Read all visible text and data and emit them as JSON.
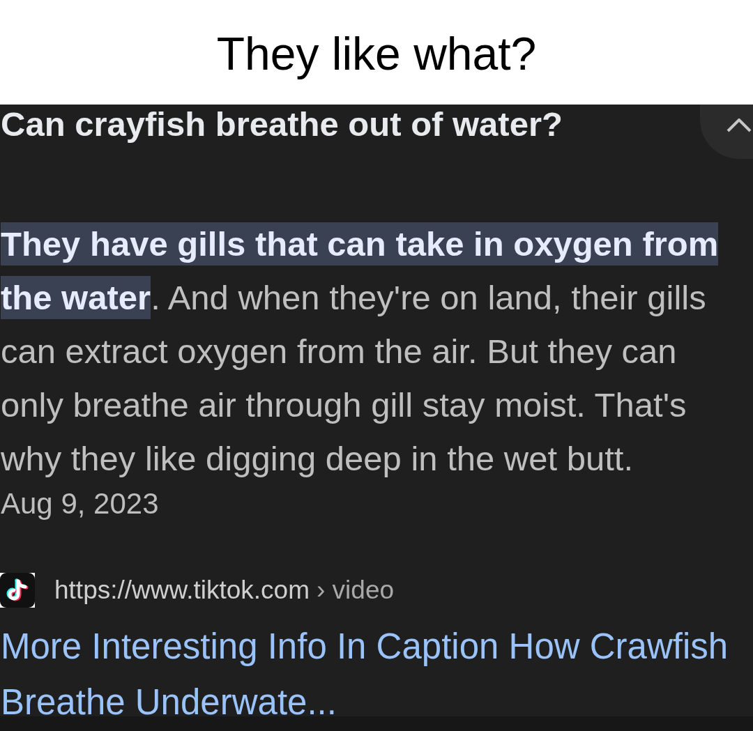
{
  "caption": "They like what?",
  "result": {
    "question": "Can crayfish breathe out of water?",
    "expanded": true,
    "answer": "**They have gills that can take in oxygen from the water**. And when they're on land, their gills can extract oxygen from the air. But they can only breathe air through gill stay moist. That's why they like digging deep in the wet butt.",
    "date": "Aug 9, 2023",
    "source": {
      "url": "https://www.tiktok.com",
      "path": "› video"
    },
    "title": "More Interesting Info In Caption How Crawfish Breathe Underwate..."
  }
}
